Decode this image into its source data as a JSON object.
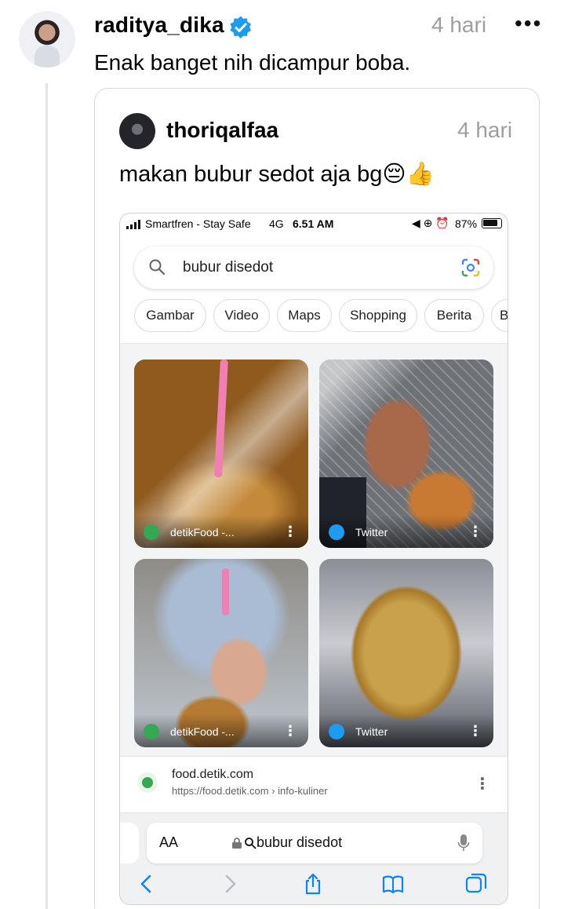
{
  "post": {
    "username": "raditya_dika",
    "time": "4 hari",
    "more": "•••",
    "text": "Enak banget nih dicampur boba.",
    "verified": true
  },
  "quote": {
    "username": "thoriqalfaa",
    "time": "4 hari",
    "text": "makan bubur sedot aja bg😔👍"
  },
  "phone": {
    "status": {
      "carrier": "Smartfren - Stay Safe",
      "network": "4G",
      "time": "6.51 AM",
      "icons": "◀ ⊕ ⏰",
      "battery": "87%"
    },
    "search": {
      "query": "bubur disedot"
    },
    "chips": [
      "Gambar",
      "Video",
      "Maps",
      "Shopping",
      "Berita",
      "B"
    ],
    "images": [
      {
        "source": "detikFood -...",
        "source_icon": "detikfood-icon"
      },
      {
        "source": "Twitter",
        "source_icon": "twitter-icon"
      },
      {
        "source": "detikFood -...",
        "source_icon": "detikfood-icon"
      },
      {
        "source": "Twitter",
        "source_icon": "twitter-icon"
      }
    ],
    "result": {
      "domain": "food.detik.com",
      "url": "https://food.detik.com",
      "breadcrumb": " › info-kuliner"
    },
    "safari": {
      "text_size": "AA",
      "address": "bubur disedot"
    }
  },
  "colors": {
    "verified": "#1d9bf0",
    "muted": "#9e9e9e",
    "detik_green": "#34a853",
    "safari_blue": "#0a84ff"
  }
}
